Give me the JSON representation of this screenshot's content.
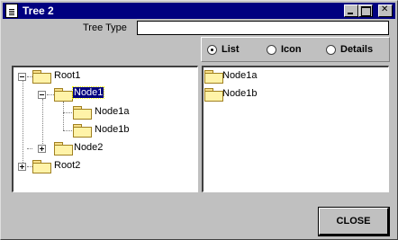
{
  "window": {
    "title": "Tree 2"
  },
  "tree_type": {
    "label": "Tree Type",
    "value": ""
  },
  "view_options": [
    {
      "label": "List",
      "selected": true
    },
    {
      "label": "Icon",
      "selected": false
    },
    {
      "label": "Details",
      "selected": false
    }
  ],
  "tree": {
    "root1": "Root1",
    "node1": "Node1",
    "node1a": "Node1a",
    "node1b": "Node1b",
    "node2": "Node2",
    "root2": "Root2"
  },
  "list": {
    "item1": "Node1a",
    "item2": "Node1b"
  },
  "buttons": {
    "close": "CLOSE"
  },
  "colors": {
    "title_bar": "#000080",
    "selection": "#000080",
    "folder": "#fff3a8"
  }
}
